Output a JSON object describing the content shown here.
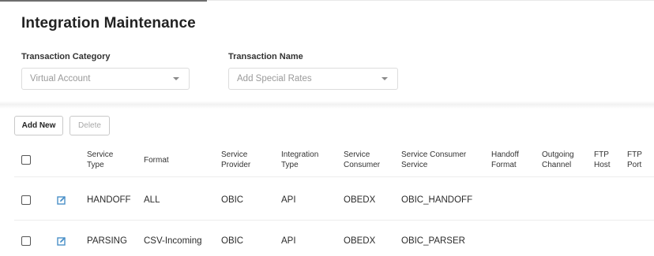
{
  "page": {
    "title": "Integration Maintenance"
  },
  "filters": {
    "category_label": "Transaction Category",
    "category_value": "Virtual Account",
    "name_label": "Transaction Name",
    "name_value": "Add Special Rates"
  },
  "toolbar": {
    "add_label": "Add New",
    "delete_label": "Delete"
  },
  "table": {
    "headers": [
      [
        "Service",
        "Type"
      ],
      [
        "Format"
      ],
      [
        "Service",
        "Provider"
      ],
      [
        "Integration",
        "Type"
      ],
      [
        "Service",
        "Consumer"
      ],
      [
        "Service Consumer",
        "Service"
      ],
      [
        "Handoff",
        "Format"
      ],
      [
        "Outgoing",
        "Channel"
      ],
      [
        "FTP",
        "Host"
      ],
      [
        "FTP",
        "Port"
      ]
    ],
    "rows": [
      {
        "service_type": "HANDOFF",
        "format": "ALL",
        "provider": "OBIC",
        "integration_type": "API",
        "consumer": "OBEDX",
        "consumer_service": "OBIC_HANDOFF"
      },
      {
        "service_type": "PARSING",
        "format": "CSV-Incoming",
        "provider": "OBIC",
        "integration_type": "API",
        "consumer": "OBEDX",
        "consumer_service": "OBIC_PARSER"
      }
    ]
  },
  "icons": {
    "edit": "edit-icon",
    "caret": "chevron-down-icon",
    "checkbox": "checkbox"
  },
  "colors": {
    "edit_icon": "#4a90c8",
    "disabled_text": "#a8a8a8"
  }
}
